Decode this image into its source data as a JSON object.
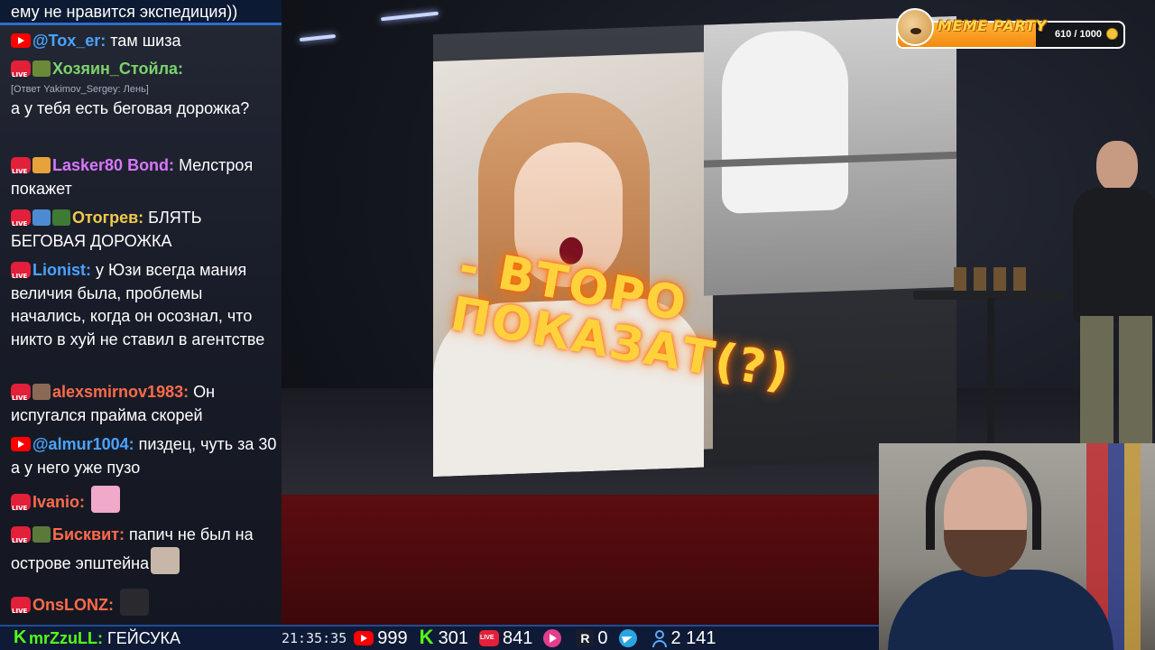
{
  "chat": {
    "messages": [
      {
        "platform": "none",
        "badges": [],
        "nick": "",
        "nick_color": "#ffffff",
        "reply": "",
        "text": "ему не нравится экспедиция))",
        "emote": ""
      },
      {
        "platform": "youtube",
        "badges": [],
        "nick": "@Tox_er:",
        "nick_color": "#4aa3ff",
        "reply": "",
        "text": "там шиза",
        "emote": ""
      },
      {
        "platform": "live",
        "badges": [
          "#6a8a3a"
        ],
        "nick": "Хозяин_Стойла:",
        "nick_color": "#7cd36b",
        "reply": "[Ответ Yakimov_Sergey: Лень]",
        "text": "а у тебя есть беговая дорожка?",
        "emote": ""
      },
      {
        "platform": "live",
        "badges": [
          "#e8a23a"
        ],
        "nick": "Lasker80 Bond:",
        "nick_color": "#d777ff",
        "reply": "",
        "text": "Мелстроя покажет",
        "emote": ""
      },
      {
        "platform": "live",
        "badges": [
          "#4c8bd4",
          "#3f7a34"
        ],
        "nick": "Отогрев:",
        "nick_color": "#f2c94c",
        "reply": "",
        "text": "БЛЯТЬ БЕГОВАЯ ДОРОЖКА",
        "emote": ""
      },
      {
        "platform": "live",
        "badges": [],
        "nick": "Lionist:",
        "nick_color": "#4aa3ff",
        "reply": "",
        "text": "у Юзи всегда мания величия была, проблемы начались, когда он осознал, что никто в хуй не ставил в агентстве",
        "emote": ""
      },
      {
        "platform": "live",
        "badges": [
          "#8a6a56"
        ],
        "nick": "alexsmirnov1983:",
        "nick_color": "#ff6b4a",
        "reply": "",
        "text": "Он испугался прайма скорей",
        "emote": ""
      },
      {
        "platform": "youtube",
        "badges": [],
        "nick": "@almur1004:",
        "nick_color": "#4aa3ff",
        "reply": "",
        "text": "пиздец, чуть за 30 а у него уже пузо",
        "emote": ""
      },
      {
        "platform": "live",
        "badges": [],
        "nick": "Ivanio:",
        "nick_color": "#ff6b4a",
        "reply": "",
        "text": "",
        "emote": "#f1a9c9"
      },
      {
        "platform": "live",
        "badges": [
          "#5b7a3a"
        ],
        "nick": "Бисквит:",
        "nick_color": "#ff6b4a",
        "reply": "",
        "text": "папич не был на острове эпштейна",
        "emote": "#c8b7a8"
      },
      {
        "platform": "live",
        "badges": [],
        "nick": "OnsLONZ:",
        "nick_color": "#ff6b4a",
        "reply": "",
        "text": "",
        "emote": "#2a2a2e"
      }
    ]
  },
  "bottom_bar": {
    "last_message": {
      "platform": "kick",
      "nick": "mrZzuLL:",
      "text": "ГЕЙСУКА"
    },
    "clock": "21:35:35",
    "stats": [
      {
        "icon": "youtube-icon",
        "value": "999"
      },
      {
        "icon": "kick-icon",
        "value": "301"
      },
      {
        "icon": "vk-live-icon",
        "value": "841"
      },
      {
        "icon": "vk-video-icon",
        "value": ""
      },
      {
        "icon": "rutube-icon",
        "value": "0"
      },
      {
        "icon": "telegram-icon",
        "value": ""
      },
      {
        "icon": "viewers-icon",
        "value": "2 141"
      }
    ]
  },
  "meme_party": {
    "title": "MEME PARTY",
    "progress_text": "610 / 1000",
    "progress_fraction": 0.61
  },
  "stage": {
    "screen_text": "- ВТОРО\nПОКАЗАТ(?)"
  },
  "colors": {
    "accent_blue": "#2f6bcc",
    "kick_green": "#53fc18",
    "youtube_red": "#ff0000",
    "live_red": "#e2203a",
    "meme_orange": "#f38a0c"
  }
}
